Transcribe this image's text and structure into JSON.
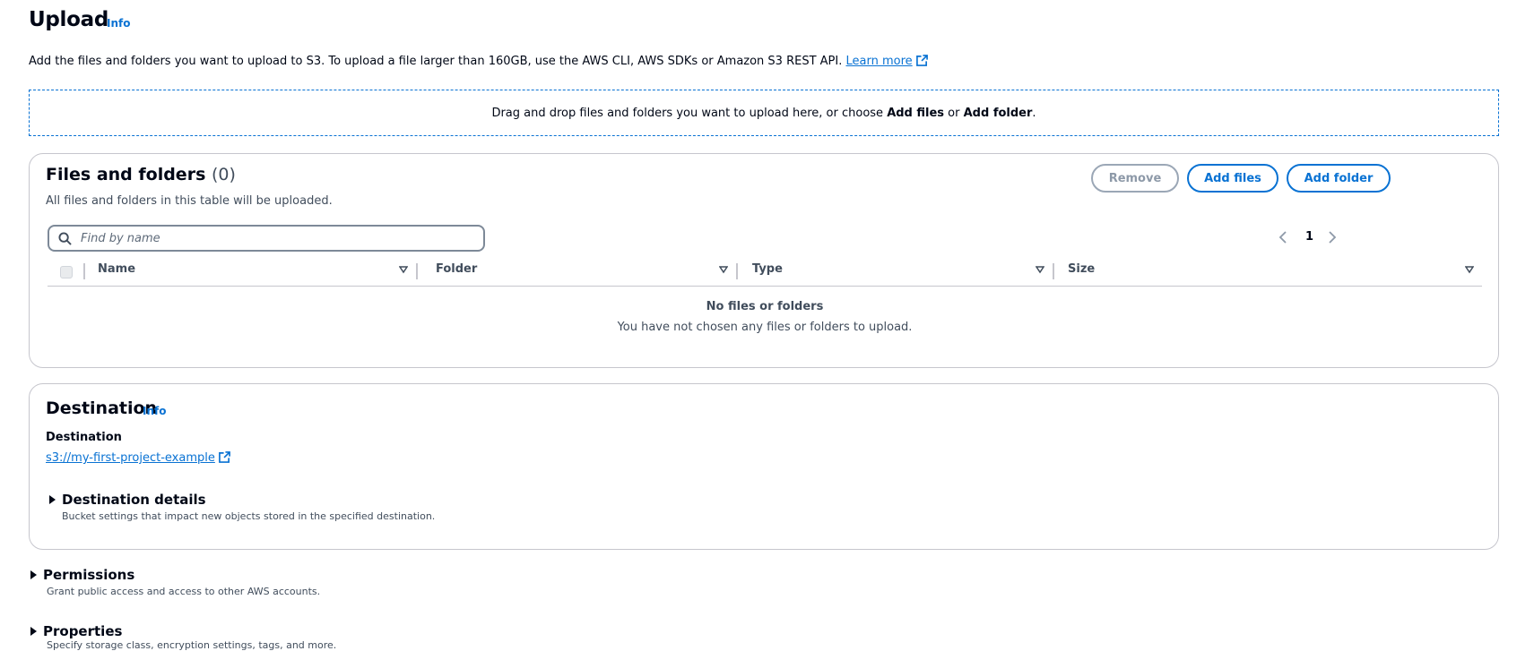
{
  "header": {
    "title": "Upload",
    "info": "Info",
    "intro_text": "Add the files and folders you want to upload to S3. To upload a file larger than 160GB, use the AWS CLI, AWS SDKs or Amazon S3 REST API.",
    "learn_more": "Learn more"
  },
  "dropzone": {
    "text_pre": "Drag and drop files and folders you want to upload here, or choose ",
    "add_files": "Add files",
    "or": " or ",
    "add_folder": "Add folder",
    "period": "."
  },
  "files": {
    "title": "Files and folders",
    "count": "(0)",
    "subtitle": "All files and folders in this table will be uploaded.",
    "remove_label": "Remove",
    "add_files_label": "Add files",
    "add_folder_label": "Add folder",
    "search_placeholder": "Find by name",
    "page": "1",
    "columns": [
      "Name",
      "Folder",
      "Type",
      "Size"
    ],
    "empty_title": "No files or folders",
    "empty_desc": "You have not chosen any files or folders to upload."
  },
  "destination": {
    "title": "Destination",
    "info": "Info",
    "label": "Destination",
    "url": "s3://my-first-project-example",
    "details_title": "Destination details",
    "details_desc": "Bucket settings that impact new objects stored in the specified destination."
  },
  "permissions": {
    "title": "Permissions",
    "desc": "Grant public access and access to other AWS accounts."
  },
  "properties": {
    "title": "Properties",
    "desc": "Specify storage class, encryption settings, tags, and more."
  },
  "colors": {
    "link": "#0972d3",
    "border": "#c6c6cd",
    "text": "#000716"
  }
}
